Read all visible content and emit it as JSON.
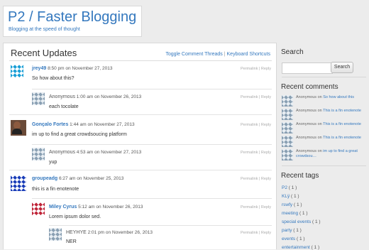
{
  "site": {
    "title": "P2 / Faster Blogging",
    "description": "Blogging at the speed of thought"
  },
  "main": {
    "title": "Recent Updates",
    "links": {
      "toggle_threads": "Toggle Comment Threads",
      "separator": "|",
      "keyboard_shortcuts": "Keyboard Shortcuts"
    }
  },
  "posts": [
    {
      "author": "jrey49",
      "time": "8:50 pm on November 27, 2013",
      "actions": "Permalink | Reply",
      "body": "So how about this?",
      "avatar": "identicon-blue"
    },
    {
      "author": "Anonymous",
      "time": "1:00 am on November 26, 2013",
      "actions": "Permalink | Reply",
      "body": "each tocolate",
      "avatar": "identicon-grey"
    },
    {
      "author": "Gonçalo Fortes",
      "time": "1:44 am on November 27, 2013",
      "actions": "Permalink | Reply",
      "body": "im up to find a great crowdsoucing platform",
      "avatar": "photo"
    },
    {
      "author": "Anonymous",
      "time": "4:53 am on November 27, 2013",
      "actions": "Permalink | Reply",
      "body": "yup",
      "avatar": "identicon-grey"
    },
    {
      "author": "groupeadg",
      "time": "6:27 am on November 25, 2013",
      "actions": "Permalink | Reply",
      "body": "this is a fin enotenote",
      "avatar": "identicon-navy"
    },
    {
      "author": "Miley Cyrus",
      "time": "5:12 am on November 26, 2013",
      "actions": "Permalink | Reply",
      "body": "Lorem ipsum dolor sed.",
      "avatar": "identicon-red"
    },
    {
      "author": "HEYHYE",
      "time": "2:01 pm on November 26, 2013",
      "actions": "Permalink | Reply",
      "body": "NER",
      "avatar": "identicon-grey"
    }
  ],
  "sidebar": {
    "search": {
      "title": "Search",
      "button": "Search",
      "placeholder": ""
    },
    "recent_comments": {
      "title": "Recent comments",
      "items": [
        {
          "author": "Anonymous",
          "on": "on",
          "target": "So how about this"
        },
        {
          "author": "Anonymous",
          "on": "on",
          "target": "This is a fin enotenote"
        },
        {
          "author": "Anonymous",
          "on": "on",
          "target": "This is a fin enotenote"
        },
        {
          "author": "Anonymous",
          "on": "on",
          "target": "This is a fin enotenote"
        },
        {
          "author": "Anonymous",
          "on": "on",
          "target": "im up to find a great crowdsou…"
        }
      ]
    },
    "recent_tags": {
      "title": "Recent tags",
      "items": [
        {
          "name": "P2",
          "count": "( 1 )"
        },
        {
          "name": "KLÿ",
          "count": "( 1 )"
        },
        {
          "name": "rswfy",
          "count": "( 1 )"
        },
        {
          "name": "meeting",
          "count": "( 1 )"
        },
        {
          "name": "special events",
          "count": "( 1 )"
        },
        {
          "name": "party",
          "count": "( 1 )"
        },
        {
          "name": "events",
          "count": "( 1 )"
        },
        {
          "name": "entertainment",
          "count": "( 1 )"
        }
      ]
    }
  },
  "colors": {
    "accent": "#3478be",
    "background": "#ececec",
    "panel": "#ffffff"
  }
}
